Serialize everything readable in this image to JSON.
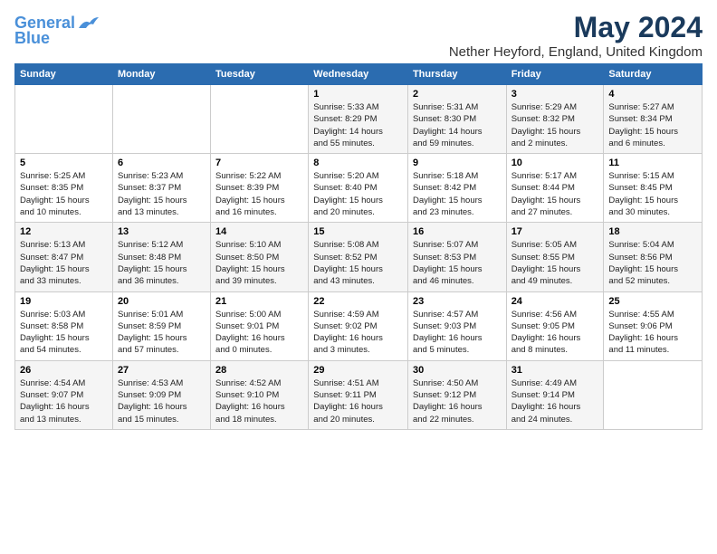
{
  "header": {
    "logo_line1": "General",
    "logo_line2": "Blue",
    "title": "May 2024",
    "location": "Nether Heyford, England, United Kingdom"
  },
  "days_of_week": [
    "Sunday",
    "Monday",
    "Tuesday",
    "Wednesday",
    "Thursday",
    "Friday",
    "Saturday"
  ],
  "weeks": [
    {
      "days": [
        {
          "num": "",
          "info": ""
        },
        {
          "num": "",
          "info": ""
        },
        {
          "num": "",
          "info": ""
        },
        {
          "num": "1",
          "info": "Sunrise: 5:33 AM\nSunset: 8:29 PM\nDaylight: 14 hours\nand 55 minutes."
        },
        {
          "num": "2",
          "info": "Sunrise: 5:31 AM\nSunset: 8:30 PM\nDaylight: 14 hours\nand 59 minutes."
        },
        {
          "num": "3",
          "info": "Sunrise: 5:29 AM\nSunset: 8:32 PM\nDaylight: 15 hours\nand 2 minutes."
        },
        {
          "num": "4",
          "info": "Sunrise: 5:27 AM\nSunset: 8:34 PM\nDaylight: 15 hours\nand 6 minutes."
        }
      ]
    },
    {
      "days": [
        {
          "num": "5",
          "info": "Sunrise: 5:25 AM\nSunset: 8:35 PM\nDaylight: 15 hours\nand 10 minutes."
        },
        {
          "num": "6",
          "info": "Sunrise: 5:23 AM\nSunset: 8:37 PM\nDaylight: 15 hours\nand 13 minutes."
        },
        {
          "num": "7",
          "info": "Sunrise: 5:22 AM\nSunset: 8:39 PM\nDaylight: 15 hours\nand 16 minutes."
        },
        {
          "num": "8",
          "info": "Sunrise: 5:20 AM\nSunset: 8:40 PM\nDaylight: 15 hours\nand 20 minutes."
        },
        {
          "num": "9",
          "info": "Sunrise: 5:18 AM\nSunset: 8:42 PM\nDaylight: 15 hours\nand 23 minutes."
        },
        {
          "num": "10",
          "info": "Sunrise: 5:17 AM\nSunset: 8:44 PM\nDaylight: 15 hours\nand 27 minutes."
        },
        {
          "num": "11",
          "info": "Sunrise: 5:15 AM\nSunset: 8:45 PM\nDaylight: 15 hours\nand 30 minutes."
        }
      ]
    },
    {
      "days": [
        {
          "num": "12",
          "info": "Sunrise: 5:13 AM\nSunset: 8:47 PM\nDaylight: 15 hours\nand 33 minutes."
        },
        {
          "num": "13",
          "info": "Sunrise: 5:12 AM\nSunset: 8:48 PM\nDaylight: 15 hours\nand 36 minutes."
        },
        {
          "num": "14",
          "info": "Sunrise: 5:10 AM\nSunset: 8:50 PM\nDaylight: 15 hours\nand 39 minutes."
        },
        {
          "num": "15",
          "info": "Sunrise: 5:08 AM\nSunset: 8:52 PM\nDaylight: 15 hours\nand 43 minutes."
        },
        {
          "num": "16",
          "info": "Sunrise: 5:07 AM\nSunset: 8:53 PM\nDaylight: 15 hours\nand 46 minutes."
        },
        {
          "num": "17",
          "info": "Sunrise: 5:05 AM\nSunset: 8:55 PM\nDaylight: 15 hours\nand 49 minutes."
        },
        {
          "num": "18",
          "info": "Sunrise: 5:04 AM\nSunset: 8:56 PM\nDaylight: 15 hours\nand 52 minutes."
        }
      ]
    },
    {
      "days": [
        {
          "num": "19",
          "info": "Sunrise: 5:03 AM\nSunset: 8:58 PM\nDaylight: 15 hours\nand 54 minutes."
        },
        {
          "num": "20",
          "info": "Sunrise: 5:01 AM\nSunset: 8:59 PM\nDaylight: 15 hours\nand 57 minutes."
        },
        {
          "num": "21",
          "info": "Sunrise: 5:00 AM\nSunset: 9:01 PM\nDaylight: 16 hours\nand 0 minutes."
        },
        {
          "num": "22",
          "info": "Sunrise: 4:59 AM\nSunset: 9:02 PM\nDaylight: 16 hours\nand 3 minutes."
        },
        {
          "num": "23",
          "info": "Sunrise: 4:57 AM\nSunset: 9:03 PM\nDaylight: 16 hours\nand 5 minutes."
        },
        {
          "num": "24",
          "info": "Sunrise: 4:56 AM\nSunset: 9:05 PM\nDaylight: 16 hours\nand 8 minutes."
        },
        {
          "num": "25",
          "info": "Sunrise: 4:55 AM\nSunset: 9:06 PM\nDaylight: 16 hours\nand 11 minutes."
        }
      ]
    },
    {
      "days": [
        {
          "num": "26",
          "info": "Sunrise: 4:54 AM\nSunset: 9:07 PM\nDaylight: 16 hours\nand 13 minutes."
        },
        {
          "num": "27",
          "info": "Sunrise: 4:53 AM\nSunset: 9:09 PM\nDaylight: 16 hours\nand 15 minutes."
        },
        {
          "num": "28",
          "info": "Sunrise: 4:52 AM\nSunset: 9:10 PM\nDaylight: 16 hours\nand 18 minutes."
        },
        {
          "num": "29",
          "info": "Sunrise: 4:51 AM\nSunset: 9:11 PM\nDaylight: 16 hours\nand 20 minutes."
        },
        {
          "num": "30",
          "info": "Sunrise: 4:50 AM\nSunset: 9:12 PM\nDaylight: 16 hours\nand 22 minutes."
        },
        {
          "num": "31",
          "info": "Sunrise: 4:49 AM\nSunset: 9:14 PM\nDaylight: 16 hours\nand 24 minutes."
        },
        {
          "num": "",
          "info": ""
        }
      ]
    }
  ]
}
